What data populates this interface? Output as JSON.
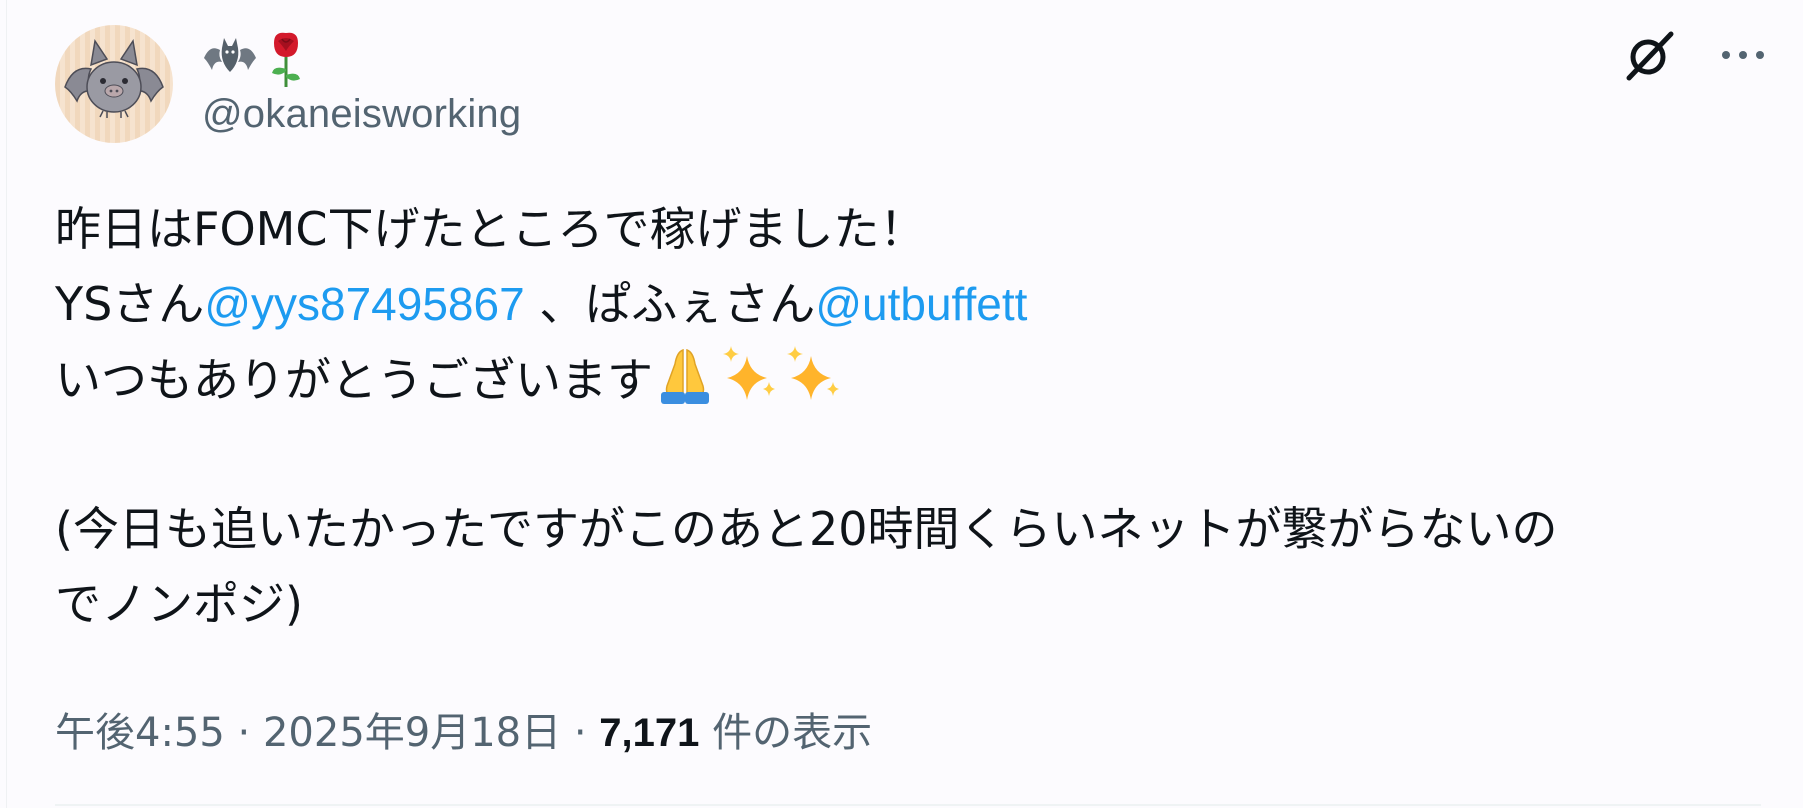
{
  "user": {
    "display_name_emojis": [
      "bat",
      "rose"
    ],
    "handle": "@okaneisworking",
    "avatar_icon": "bat-avatar"
  },
  "top_actions": {
    "grok_icon": "grok-icon",
    "more_icon": "more-icon"
  },
  "tweet": {
    "line1": "昨日はFOMC下げたところで稼げました！",
    "line2_prefix": "YSさん",
    "mention1": "@yys87495867",
    "line2_middle": " 、ぱふぇさん",
    "mention2": "@utbuffett",
    "line3": "いつもありがとうございます",
    "line3_emojis": [
      "folded-hands",
      "sparkles",
      "sparkles"
    ],
    "line4": "(今日も追いたかったですがこのあと20時間くらいネットが繋がらないの",
    "line5": "でノンポジ)"
  },
  "meta": {
    "time": "午後4:55",
    "separator": " · ",
    "date": "2025年9月18日",
    "views_count": "7,171",
    "views_label": " 件の表示"
  },
  "colors": {
    "background": "#fcfbfe",
    "text": "#0f1419",
    "secondary": "#536471",
    "link": "#1d9bf0"
  }
}
